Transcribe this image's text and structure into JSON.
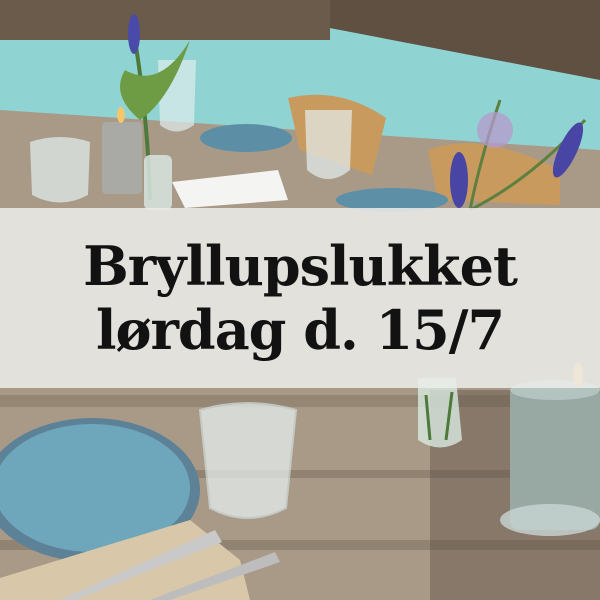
{
  "banner": {
    "line1": "Bryllupslukket",
    "line2": "lørdag d. 15/7"
  },
  "colors": {
    "wall": "#8fd3d3",
    "wood_table": "#a99a88",
    "plate_blue": "#6a9fb3",
    "candle": "#98a9a4",
    "banner_bg": "#ececea",
    "text": "#121212"
  }
}
